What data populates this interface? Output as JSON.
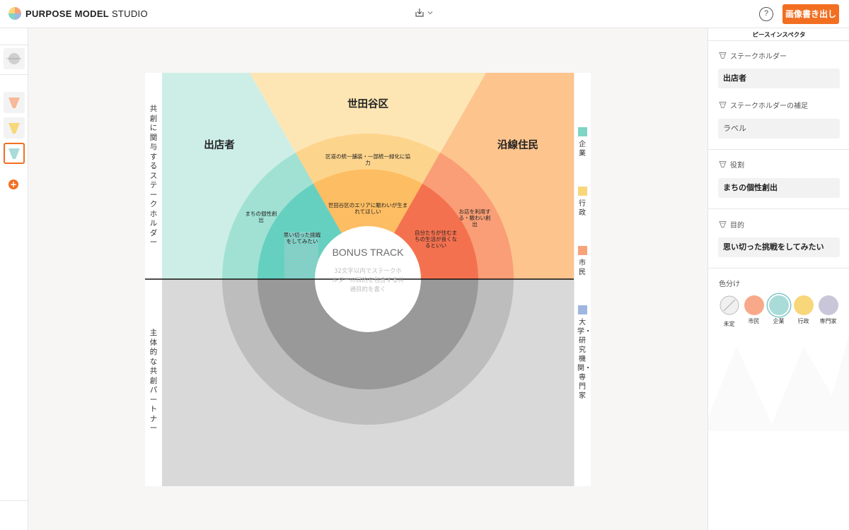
{
  "app": {
    "brand_bold": "PURPOSE MODEL",
    "brand_light": "STUDIO",
    "export_label": "画像書き出し",
    "help_label": "?"
  },
  "canvas": {
    "left_label_top": "共創に関与するステークホルダー",
    "left_label_bottom": "主体的な共創パートナー",
    "sectors": {
      "left": "出店者",
      "center": "世田谷区",
      "right": "沿線住民"
    },
    "outer_texts": {
      "left": "まちの個性創出",
      "center": "区道の統一舗装・一部統一緑化に協力",
      "right": "お店を利用する・賑わい創出"
    },
    "inner_texts": {
      "left": "思い切った挑戦をしてみたい",
      "center": "世田谷区のエリアに賑わいが生まれてほしい",
      "right": "自分たちが住むまちの生活が良くなるといい"
    },
    "bonus": {
      "title": "BONUS TRACK",
      "desc": "32文字以内でステークホルダーの目的を包含する共通目的を書く"
    },
    "legend": [
      {
        "label": "企業",
        "color": "#7fd4c3"
      },
      {
        "label": "行政",
        "color": "#f8d77a"
      },
      {
        "label": "市民",
        "color": "#f8a27a"
      },
      {
        "label": "大学・研究機関・専門家",
        "color": "#9fb6e0"
      }
    ]
  },
  "inspector": {
    "title": "ピースインスペクタ",
    "stakeholder_label": "ステークホルダー",
    "stakeholder_value": "出店者",
    "supplement_label": "ステークホルダーの補足",
    "supplement_value": "ラベル",
    "role_label": "役割",
    "role_value": "まちの個性創出",
    "purpose_label": "目的",
    "purpose_value": "思い切った挑戦をしてみたい",
    "color_label": "色分け",
    "colors": [
      {
        "label": "未定",
        "color": "#f0f0f0"
      },
      {
        "label": "市民",
        "color": "#f8a98a"
      },
      {
        "label": "企業",
        "color": "#a9dcd9"
      },
      {
        "label": "行政",
        "color": "#f8d77a"
      },
      {
        "label": "専門家",
        "color": "#c9c6d9"
      }
    ]
  }
}
